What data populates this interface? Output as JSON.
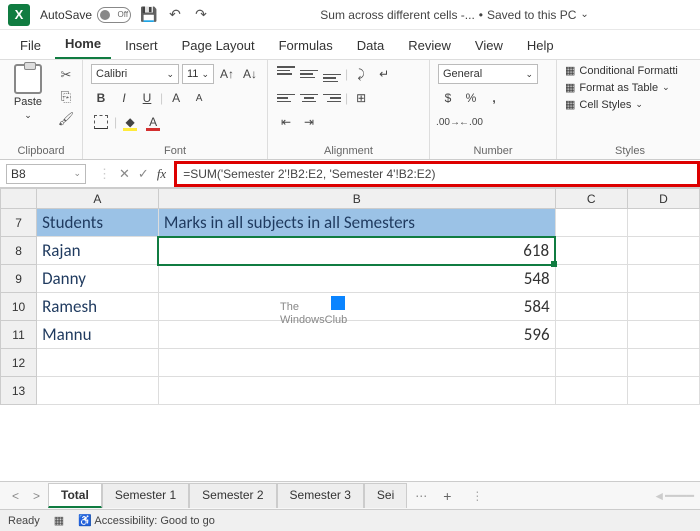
{
  "titlebar": {
    "autosave_label": "AutoSave",
    "autosave_state": "Off",
    "doc_name": "Sum across different cells -...",
    "save_status": "Saved to this PC"
  },
  "menu": {
    "items": [
      "File",
      "Home",
      "Insert",
      "Page Layout",
      "Formulas",
      "Data",
      "Review",
      "View",
      "Help"
    ],
    "active": "Home"
  },
  "ribbon": {
    "clipboard": {
      "label": "Clipboard",
      "paste": "Paste"
    },
    "font": {
      "label": "Font",
      "name": "Calibri",
      "size": "11"
    },
    "alignment": {
      "label": "Alignment"
    },
    "number": {
      "label": "Number",
      "format": "General"
    },
    "styles": {
      "label": "Styles",
      "conditional": "Conditional Formatti",
      "table": "Format as Table",
      "cell": "Cell Styles"
    }
  },
  "namebox": "B8",
  "formula": "=SUM('Semester 2'!B2:E2, 'Semester 4'!B2:E2)",
  "columns": [
    "A",
    "B",
    "C",
    "D"
  ],
  "rows": [
    {
      "n": "7",
      "a": "Students",
      "b": "Marks in all subjects in all Semesters",
      "header": true
    },
    {
      "n": "8",
      "a": "Rajan",
      "b": "618",
      "active": true
    },
    {
      "n": "9",
      "a": "Danny",
      "b": "548"
    },
    {
      "n": "10",
      "a": "Ramesh",
      "b": "584"
    },
    {
      "n": "11",
      "a": "Mannu",
      "b": "596"
    },
    {
      "n": "12",
      "a": "",
      "b": ""
    },
    {
      "n": "13",
      "a": "",
      "b": ""
    }
  ],
  "watermark": {
    "line1": "The",
    "line2": "WindowsClub"
  },
  "sheets": {
    "tabs": [
      "Total",
      "Semester 1",
      "Semester 2",
      "Semester 3",
      "Sei"
    ],
    "active": "Total"
  },
  "status": {
    "ready": "Ready",
    "access": "Accessibility: Good to go"
  }
}
